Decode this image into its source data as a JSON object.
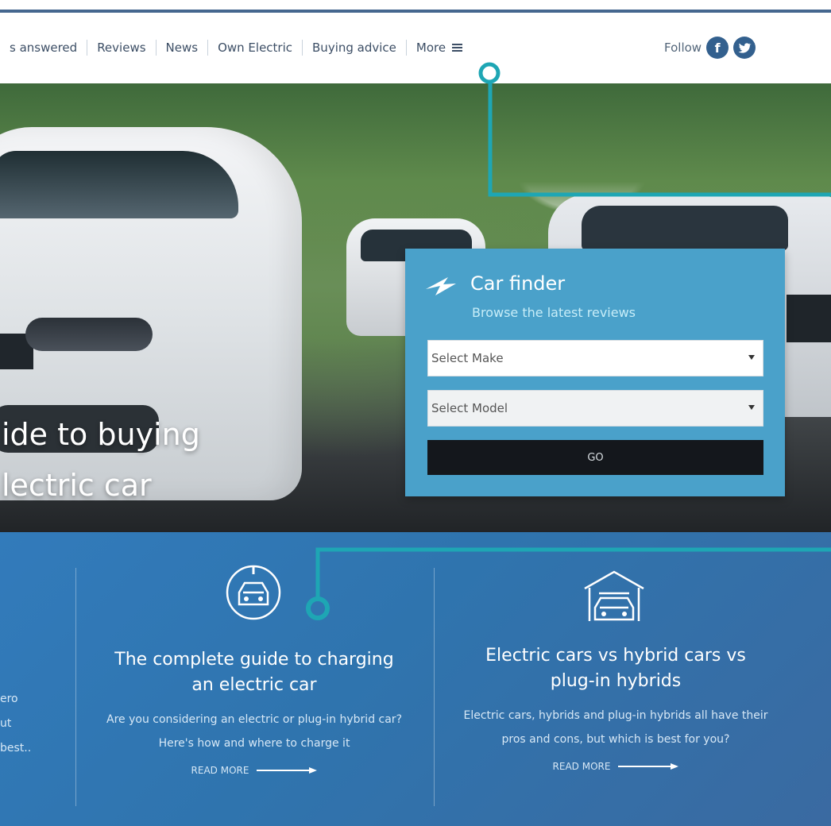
{
  "nav": {
    "items": [
      "s answered",
      "Reviews",
      "News",
      "Own Electric",
      "Buying advice",
      "More"
    ],
    "follow_label": "Follow",
    "facebook_letter": "f"
  },
  "hero": {
    "heading_line1": "ide to buying",
    "heading_line2": "lectric car"
  },
  "car_finder": {
    "title": "Car finder",
    "subtitle": "Browse the latest reviews",
    "make_placeholder": "Select Make",
    "model_placeholder": "Select Model",
    "go_label": "GO"
  },
  "edge_text": [
    "ero",
    "ut",
    "best.."
  ],
  "cards": [
    {
      "title": "The complete guide to charging an electric car",
      "description": "Are you considering an electric or plug-in hybrid car? Here's how and where to charge it",
      "read_more": "READ MORE",
      "icon": "charging-car-icon"
    },
    {
      "title": "Electric cars vs hybrid cars vs plug-in hybrids",
      "description": "Electric cars, hybrids and plug-in hybrids all have their pros and cons, but which is best for you?",
      "read_more": "READ MORE",
      "icon": "garage-car-icon"
    }
  ],
  "colors": {
    "primary_blue": "#2f74ae",
    "accent_teal": "#1ea6b4",
    "finder_blue": "#4aa1ca",
    "dark_button": "#14171c"
  }
}
